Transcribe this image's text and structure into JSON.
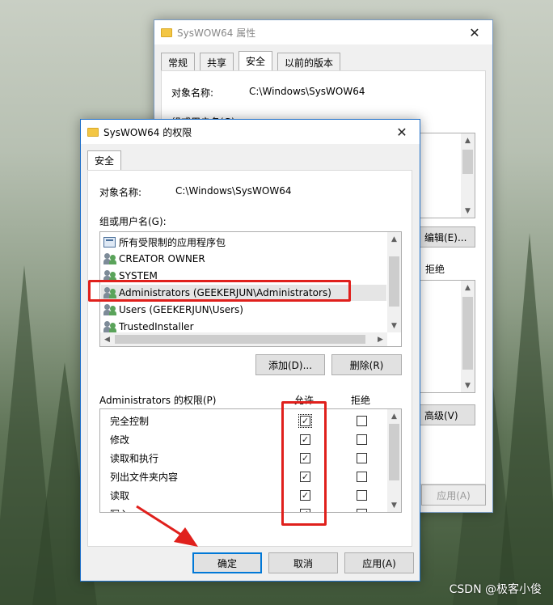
{
  "back_window": {
    "title": "SysWOW64 属性",
    "tabs": [
      "常规",
      "共享",
      "安全",
      "以前的版本"
    ],
    "object_label": "对象名称:",
    "object_value": "C:\\Windows\\SysWOW64",
    "group_label": "组或用户名(G):",
    "edit_button": "编辑(E)...",
    "deny_label": "拒绝",
    "advanced_button": "高级(V)",
    "apply_button": "应用(A)"
  },
  "dialog": {
    "title": "SysWOW64 的权限",
    "tab": "安全",
    "object_label": "对象名称:",
    "object_value": "C:\\Windows\\SysWOW64",
    "group_label": "组或用户名(G):",
    "users": [
      {
        "name": "所有受限制的应用程序包",
        "icon": "app-package-icon"
      },
      {
        "name": "CREATOR OWNER",
        "icon": "users-icon"
      },
      {
        "name": "SYSTEM",
        "icon": "users-icon"
      },
      {
        "name": "Administrators (GEEKERJUN\\Administrators)",
        "icon": "users-icon",
        "selected": true
      },
      {
        "name": "Users (GEEKERJUN\\Users)",
        "icon": "users-icon"
      },
      {
        "name": "TrustedInstaller",
        "icon": "users-icon"
      }
    ],
    "add_button": "添加(D)...",
    "remove_button": "删除(R)",
    "perm_header": "Administrators 的权限(P)",
    "allow_label": "允许",
    "deny_label": "拒绝",
    "permissions": [
      {
        "name": "完全控制",
        "allow": true,
        "deny": false
      },
      {
        "name": "修改",
        "allow": true,
        "deny": false
      },
      {
        "name": "读取和执行",
        "allow": true,
        "deny": false
      },
      {
        "name": "列出文件夹内容",
        "allow": true,
        "deny": false
      },
      {
        "name": "读取",
        "allow": true,
        "deny": false
      },
      {
        "name": "写入",
        "allow": true,
        "deny": false
      }
    ],
    "ok_button": "确定",
    "cancel_button": "取消",
    "apply_button": "应用(A)"
  },
  "watermark": "CSDN @极客小俊",
  "colors": {
    "highlight": "#e0201c",
    "accent": "#0078d7"
  }
}
